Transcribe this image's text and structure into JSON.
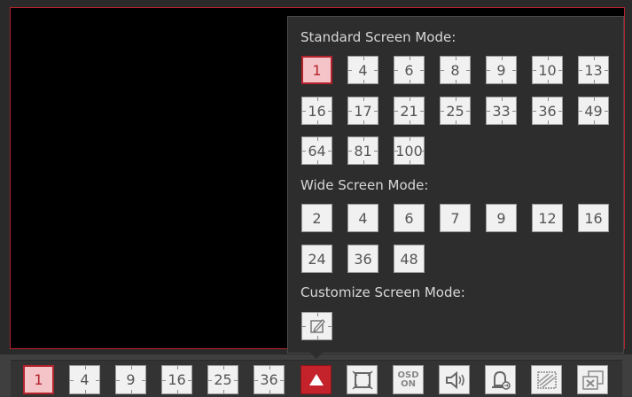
{
  "popup": {
    "standard_title": "Standard Screen Mode:",
    "standard_modes": [
      "1",
      "4",
      "6",
      "8",
      "9",
      "10",
      "13",
      "16",
      "17",
      "21",
      "25",
      "33",
      "36",
      "49",
      "64",
      "81",
      "100"
    ],
    "wide_title": "Wide Screen Mode:",
    "wide_modes": [
      "2",
      "4",
      "6",
      "7",
      "9",
      "12",
      "16",
      "24",
      "36",
      "48"
    ],
    "custom_title": "Customize Screen Mode:",
    "custom_icon": "edit-icon"
  },
  "toolbar": {
    "layouts": [
      "1",
      "4",
      "9",
      "16",
      "25",
      "36"
    ],
    "osd_line1": "OSD",
    "osd_line2": "ON",
    "icons": [
      "screen-mode-toggle-icon",
      "fullscreen-icon",
      "osd-on-icon",
      "audio-icon",
      "alarm-icon",
      "region-icon",
      "close-all-icon"
    ]
  },
  "colors": {
    "accent": "#b4232c",
    "active_bg": "#f4c4c8",
    "button_bg": "#f1f1f1"
  }
}
